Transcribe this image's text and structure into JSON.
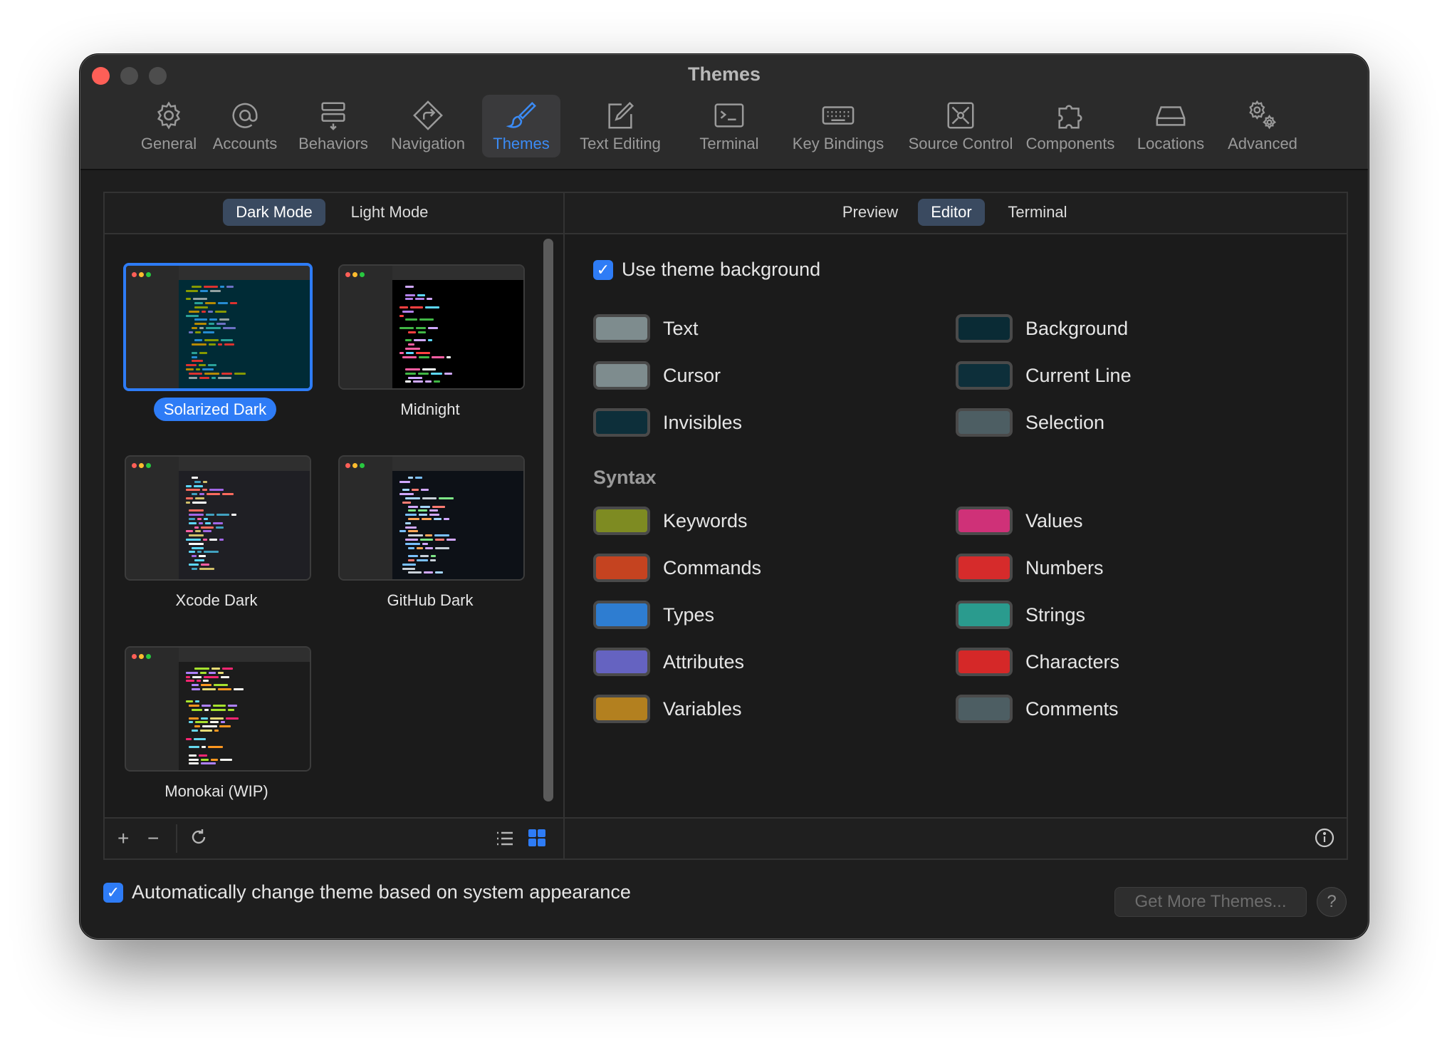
{
  "window": {
    "title": "Themes"
  },
  "toolbar": {
    "items": [
      {
        "label": "General",
        "icon": "gear-icon"
      },
      {
        "label": "Accounts",
        "icon": "at-icon"
      },
      {
        "label": "Behaviors",
        "icon": "behaviors-icon"
      },
      {
        "label": "Navigation",
        "icon": "navigation-icon"
      },
      {
        "label": "Themes",
        "icon": "paintbrush-icon"
      },
      {
        "label": "Text Editing",
        "icon": "pencil-square-icon"
      },
      {
        "label": "Terminal",
        "icon": "terminal-icon"
      },
      {
        "label": "Key Bindings",
        "icon": "keyboard-icon"
      },
      {
        "label": "Source Control",
        "icon": "source-control-icon"
      },
      {
        "label": "Components",
        "icon": "puzzle-icon"
      },
      {
        "label": "Locations",
        "icon": "drive-icon"
      },
      {
        "label": "Advanced",
        "icon": "gears-icon"
      }
    ],
    "active": "Themes"
  },
  "mode_tabs": {
    "dark": "Dark Mode",
    "light": "Light Mode",
    "active": "Dark Mode"
  },
  "themes": [
    {
      "name": "Solarized Dark",
      "selected": true,
      "bg": "#002b36"
    },
    {
      "name": "Midnight",
      "selected": false,
      "bg": "#000000"
    },
    {
      "name": "Xcode Dark",
      "selected": false,
      "bg": "#1f1f24"
    },
    {
      "name": "GitHub Dark",
      "selected": false,
      "bg": "#0d1117"
    },
    {
      "name": "Monokai (WIP)",
      "selected": false,
      "bg": "#1c1c1c"
    }
  ],
  "editor_tabs": {
    "preview": "Preview",
    "editor": "Editor",
    "terminal": "Terminal",
    "active": "Editor"
  },
  "use_theme_background": {
    "label": "Use theme background",
    "checked": true
  },
  "colors": {
    "text": {
      "label": "Text",
      "color": "#7e8c8e"
    },
    "background": {
      "label": "Background",
      "color": "#0a2b35"
    },
    "cursor": {
      "label": "Cursor",
      "color": "#7e8c8e"
    },
    "current_line": {
      "label": "Current Line",
      "color": "#0d2f3a"
    },
    "invisibles": {
      "label": "Invisibles",
      "color": "#0d2f3a"
    },
    "selection": {
      "label": "Selection",
      "color": "#4d5e63"
    }
  },
  "syntax": {
    "title": "Syntax",
    "keywords": {
      "label": "Keywords",
      "color": "#7e8b22"
    },
    "values": {
      "label": "Values",
      "color": "#cf3178"
    },
    "commands": {
      "label": "Commands",
      "color": "#c54320"
    },
    "numbers": {
      "label": "Numbers",
      "color": "#d62b2b"
    },
    "types": {
      "label": "Types",
      "color": "#2e7dd1"
    },
    "strings": {
      "label": "Strings",
      "color": "#2a9b8e"
    },
    "attributes": {
      "label": "Attributes",
      "color": "#6563c1"
    },
    "characters": {
      "label": "Characters",
      "color": "#d52828"
    },
    "variables": {
      "label": "Variables",
      "color": "#b3801f"
    },
    "comments": {
      "label": "Comments",
      "color": "#4d5e63"
    }
  },
  "footer": {
    "auto_change": {
      "label": "Automatically change theme based on system appearance",
      "checked": true
    },
    "get_more": "Get More Themes...",
    "help": "?"
  }
}
